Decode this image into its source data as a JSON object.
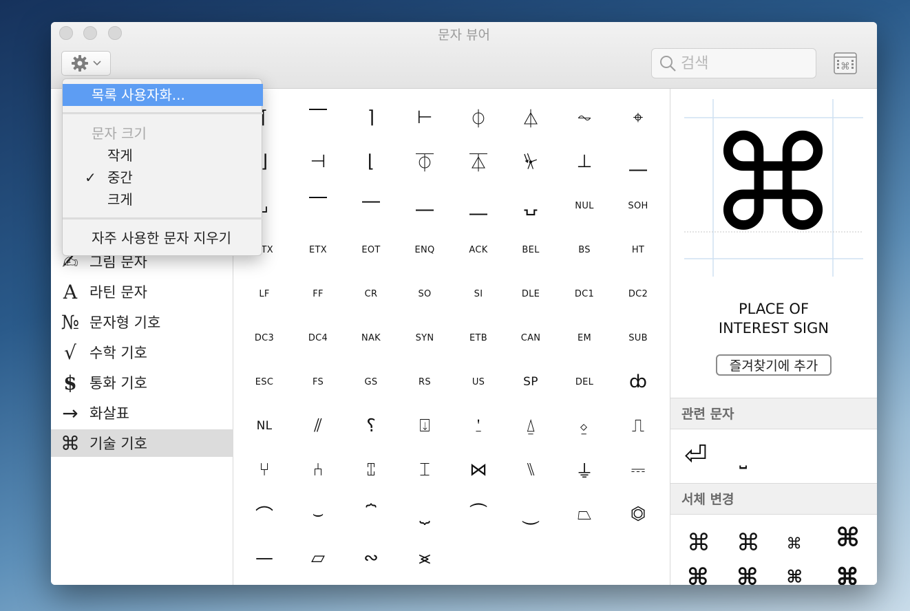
{
  "window": {
    "title": "문자 뷰어"
  },
  "toolbar": {
    "search_placeholder": "검색"
  },
  "menu": {
    "customize": "목록 사용자화...",
    "size_header": "문자 크기",
    "size_small": "작게",
    "size_medium": "중간",
    "size_large": "크게",
    "checkmark": "✓",
    "clear_recent": "자주 사용한 문자 지우기"
  },
  "sidebar": {
    "items": [
      {
        "icon": "✍",
        "label": "그림 문자"
      },
      {
        "icon": "A",
        "label": "라틴 문자"
      },
      {
        "icon": "№",
        "label": "문자형 기호"
      },
      {
        "icon": "√",
        "label": "수학 기호"
      },
      {
        "icon": "$",
        "label": "통화 기호"
      },
      {
        "icon": "→",
        "label": "화살표"
      },
      {
        "icon": "⌘",
        "label": "기술 기호"
      }
    ]
  },
  "chars": {
    "row0": [
      "⌈",
      "⎺",
      "⌉",
      "⊢",
      "⏀",
      "⏃",
      "⏦",
      "⌖"
    ],
    "row1": [
      "⌋",
      "⊣",
      "⌊",
      "⏁",
      "⏄",
      "⏧",
      "⊥",
      "⎽"
    ],
    "row2": [
      "⌟",
      "⎺",
      "⎻",
      "⎼",
      "⎽",
      "⍽",
      "NUL",
      "SOH"
    ],
    "row3": [
      "STX",
      "ETX",
      "EOT",
      "ENQ",
      "ACK",
      "BEL",
      "BS",
      "HT"
    ],
    "row4": [
      "LF",
      "FF",
      "CR",
      "SO",
      "SI",
      "DLE",
      "DC1",
      "DC2"
    ],
    "row5": [
      "DC3",
      "DC4",
      "NAK",
      "SYN",
      "ETB",
      "CAN",
      "EM",
      "SUB"
    ],
    "row6": [
      "ESC",
      "FS",
      "GS",
      "RS",
      "US",
      "SP",
      "DEL",
      "ȸ"
    ],
    "row7": [
      "NL",
      "⫽",
      "⸮",
      "⍗",
      "⍘",
      "⍙",
      "⍚",
      "⎍"
    ],
    "row8": [
      "⑂",
      "⑃",
      "⑄",
      "⌶",
      "⋈",
      "⑊",
      "⏚",
      "⎓"
    ],
    "row9": [
      "⌒",
      "⌣",
      "⏞",
      "⏟",
      "⏜",
      "⏝",
      "⏢",
      "⏣"
    ],
    "row10": [
      "—",
      "▱",
      "∾",
      "⪤"
    ]
  },
  "detail": {
    "preview_char": "⌘",
    "name_line1": "PLACE OF",
    "name_line2": "INTEREST SIGN",
    "fav_button": "즐겨찾기에 추가",
    "related_header": "관련 문자",
    "related": [
      "⏎",
      "⎵"
    ],
    "font_header": "서체 변경",
    "font_variant_char": "⌘"
  }
}
